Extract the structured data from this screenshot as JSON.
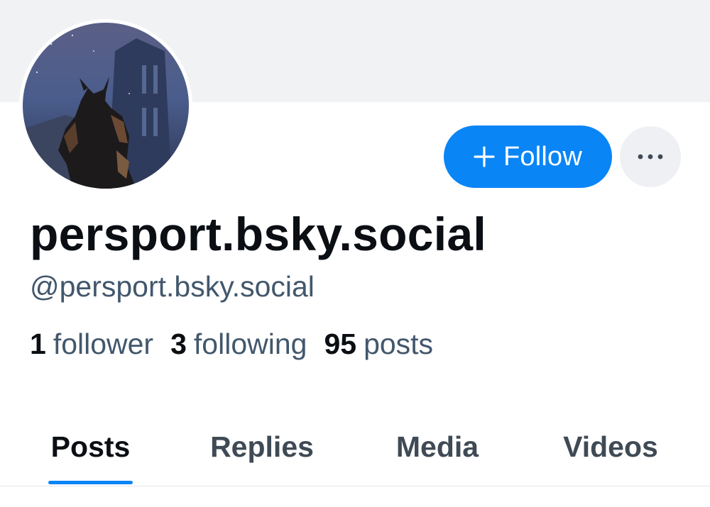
{
  "profile": {
    "display_name": "persport.bsky.social",
    "handle": "@persport.bsky.social",
    "avatar_icon": "avatar-image"
  },
  "actions": {
    "follow_label": "Follow",
    "follow_icon": "plus-icon",
    "more_icon": "ellipsis-icon",
    "accent_color": "#0a85f6"
  },
  "stats": {
    "followers_count": "1",
    "followers_label": "follower",
    "following_count": "3",
    "following_label": "following",
    "posts_count": "95",
    "posts_label": "posts"
  },
  "tabs": [
    {
      "label": "Posts",
      "active": true
    },
    {
      "label": "Replies",
      "active": false
    },
    {
      "label": "Media",
      "active": false
    },
    {
      "label": "Videos",
      "active": false
    }
  ]
}
